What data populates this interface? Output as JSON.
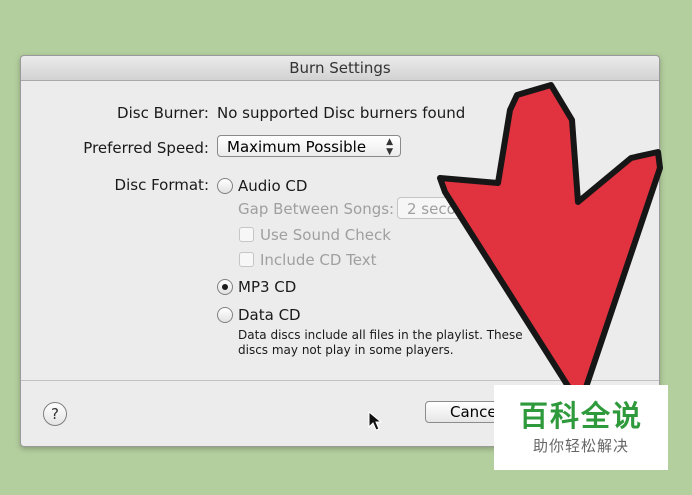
{
  "dialog": {
    "title": "Burn Settings",
    "disc_burner_label": "Disc Burner:",
    "disc_burner_value": "No supported Disc burners found",
    "preferred_speed_label": "Preferred Speed:",
    "preferred_speed_value": "Maximum Possible",
    "disc_format_label": "Disc Format:",
    "audio_cd_label": "Audio CD",
    "gap_between_songs_label": "Gap Between Songs:",
    "gap_value": "2 seco",
    "use_sound_check_label": "Use Sound Check",
    "include_cd_text_label": "Include CD Text",
    "mp3_cd_label": "MP3 CD",
    "data_cd_label": "Data CD",
    "data_cd_note_line1": "Data discs include all files in the playlist.  These",
    "data_cd_note_line2": "discs may not play in some players.",
    "selected_format": "MP3 CD",
    "help_label": "?",
    "cancel_label": "Cance"
  },
  "overlay": {
    "arrow_color": "#e0323f",
    "watermark_title": "百科全说",
    "watermark_subtitle": "助你轻松解决",
    "watermark_color": "#2f9a3c"
  },
  "icons": [
    "red-arrow-icon",
    "mouse-pointer-icon",
    "select-arrows-icon"
  ]
}
